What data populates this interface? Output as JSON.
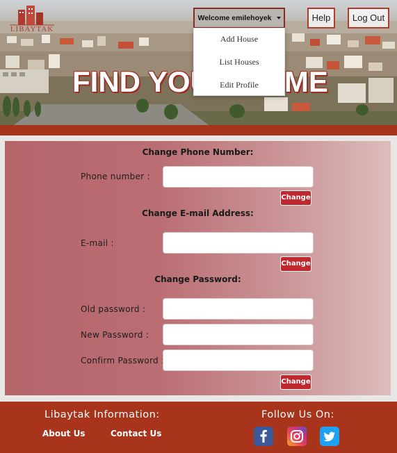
{
  "brand": {
    "logo_text": "LIBAYTAK",
    "accent": "#b03a2e"
  },
  "hero": {
    "title": "FIND YOUR HOME"
  },
  "nav": {
    "welcome_label": "Welcome emilehoyek",
    "help_label": "Help",
    "logout_label": "Log Out",
    "dropdown": [
      "Add House",
      "List Houses",
      "Edit Profile"
    ]
  },
  "form": {
    "phone_section_title": "Change Phone Number:",
    "phone_label": "Phone number :",
    "phone_value": "",
    "email_section_title": "Change E-mail Address:",
    "email_label": "E-mail :",
    "email_value": "",
    "password_section_title": "Change Password:",
    "old_password_label": "Old password :",
    "new_password_label": "New Password :",
    "confirm_password_label": "Confirm Password :",
    "change_label": "Change",
    "button_color": "#c0282f"
  },
  "footer": {
    "info_heading": "Libaytak Information:",
    "about_label": "About Us",
    "contact_label": "Contact Us",
    "follow_heading": "Follow Us On:",
    "social_icons": [
      "facebook-icon",
      "instagram-icon",
      "twitter-icon"
    ],
    "background": "#a8341c"
  }
}
